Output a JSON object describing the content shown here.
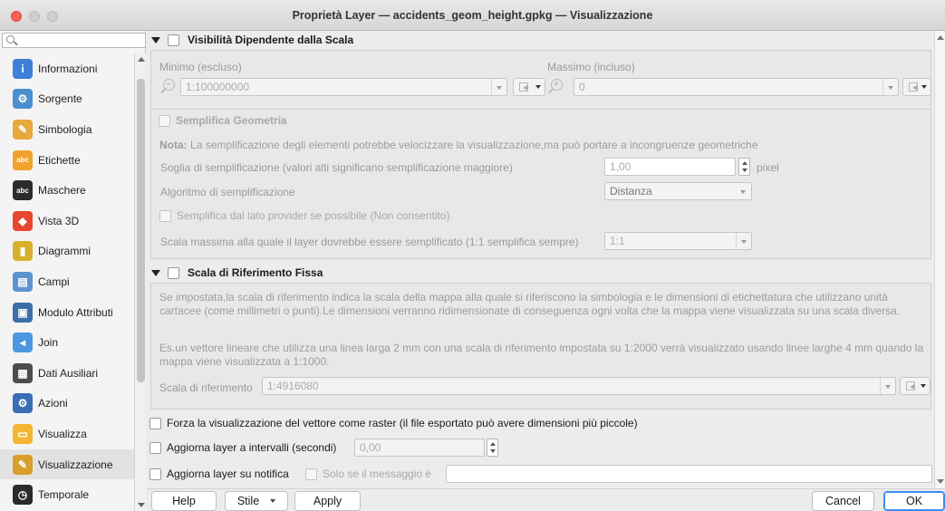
{
  "window": {
    "title": "Proprietà Layer — accidents_geom_height.gpkg — Visualizzazione"
  },
  "sidebar": {
    "search_placeholder": "",
    "items": [
      {
        "label": "Informazioni",
        "icon": "info-icon",
        "color": "#3f7fd8"
      },
      {
        "label": "Sorgente",
        "icon": "source-settings-icon",
        "color": "#4a8fd0"
      },
      {
        "label": "Simbologia",
        "icon": "symbology-brush-icon",
        "color": "#e6a93b"
      },
      {
        "label": "Etichette",
        "icon": "labels-abc-icon",
        "color": "#f1a22d"
      },
      {
        "label": "Maschere",
        "icon": "masks-abc-icon",
        "color": "#2b2b2b"
      },
      {
        "label": "Vista 3D",
        "icon": "3d-cube-icon",
        "color": "#e8462e"
      },
      {
        "label": "Diagrammi",
        "icon": "diagrams-icon",
        "color": "#d8b12c"
      },
      {
        "label": "Campi",
        "icon": "fields-table-icon",
        "color": "#5e93cf"
      },
      {
        "label": "Modulo Attributi",
        "icon": "attribute-form-icon",
        "color": "#3c6fa8"
      },
      {
        "label": "Join",
        "icon": "join-icon",
        "color": "#4b98e0"
      },
      {
        "label": "Dati Ausiliari",
        "icon": "auxiliary-storage-icon",
        "color": "#4d4d4d"
      },
      {
        "label": "Azioni",
        "icon": "actions-gear-icon",
        "color": "#3a6db5"
      },
      {
        "label": "Visualizza",
        "icon": "display-tooltip-icon",
        "color": "#f4b630"
      },
      {
        "label": "Visualizzazione",
        "icon": "rendering-brush-icon",
        "color": "#d89f2b"
      },
      {
        "label": "Temporale",
        "icon": "temporal-clock-icon",
        "color": "#2b2b2b"
      }
    ],
    "selected_index": 13
  },
  "scale_visibility": {
    "title": "Visibilità Dipendente dalla Scala",
    "min_label": "Minimo (escluso)",
    "min_value": "1:100000000",
    "max_label": "Massimo (incluso)",
    "max_value": "0"
  },
  "simplify": {
    "title": "Semplifica Geometria",
    "note_bold": "Nota:",
    "note_text": "La semplificazione degli elementi potrebbe velocizzare la visualizzazione,ma può portare a incongruenze geometriche",
    "threshold_label": "Soglia di semplificazione (valori alti significano semplificazione maggiore)",
    "threshold_value": "1,00",
    "threshold_unit": "pixel",
    "algorithm_label": "Algoritmo di semplificazione",
    "algorithm_value": "Distanza",
    "provider_label": "Semplifica dal lato provider se possibile (Non consentito)",
    "max_scale_label": "Scala massima alla quale il layer dovrebbe essere semplificato (1:1 semplifica sempre)",
    "max_scale_value": "1:1"
  },
  "reference_scale": {
    "title": "Scala di Riferimento Fissa",
    "desc1": "Se impostata,la scala di riferimento indica la scala della mappa alla quale si riferiscono la simbologia e le dimensioni di etichettatura che utilizzano unità cartacee (come millimetri o punti).Le dimensioni verranno ridimensionate di conseguenza ogni volta che la mappa viene visualizzata su una scala diversa.",
    "desc2": "Es.un vettore lineare che utilizza una linea larga 2 mm con una scala di riferimento impostata su 1:2000 verrà visualizzato usando linee larghe 4 mm quando la mappa viene visualizzata a 1:1000.",
    "scale_label": "Scala di riferimento",
    "scale_value": "1:4916080"
  },
  "options": {
    "force_raster": "Forza la visualizzazione del vettore come raster (il file esportato può avere dimensioni più piccole)",
    "refresh_interval": "Aggiorna layer a intervalli (secondi)",
    "refresh_value": "0,00",
    "refresh_notify": "Aggiorna layer su notifica",
    "only_if_message": "Solo se il messaggio è",
    "message_value": ""
  },
  "buttons": {
    "help": "Help",
    "style": "Stile",
    "apply": "Apply",
    "cancel": "Cancel",
    "ok": "OK"
  }
}
